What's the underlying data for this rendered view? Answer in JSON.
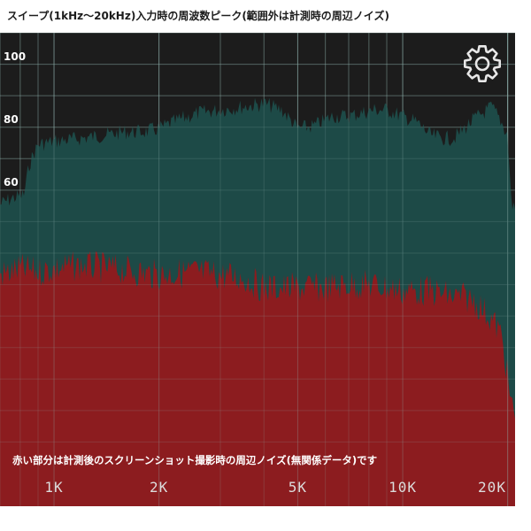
{
  "header": {
    "title": "スイープ(1kHz〜20kHz)入力時の周波数ピーク(範囲外は計測時の周辺ノイズ)"
  },
  "analyzer": {
    "caption": "赤い部分は計測後のスクリーンショット撮影時の周辺ノイズ(無関係データ)です",
    "settings_icon": "gear-icon",
    "colors": {
      "background": "#1c1c1c",
      "grid": "#8fb3ad",
      "sweep": "#1d4a47",
      "noise": "#8c1c1f"
    }
  },
  "chart_data": {
    "type": "area",
    "title": "",
    "xlabel": "",
    "ylabel": "",
    "x_scale": "log",
    "x_ticks": [
      {
        "value": 1000,
        "label": "1K"
      },
      {
        "value": 2000,
        "label": "2K"
      },
      {
        "value": 5000,
        "label": "5K"
      },
      {
        "value": 10000,
        "label": "10K"
      },
      {
        "value": 20000,
        "label": "20K"
      }
    ],
    "y_ticks": [
      {
        "value": 100,
        "label": "100"
      },
      {
        "value": 80,
        "label": "80"
      },
      {
        "value": 60,
        "label": "60"
      }
    ],
    "xlim": [
      700,
      21000
    ],
    "ylim": [
      -30,
      110
    ],
    "grid": true,
    "series": [
      {
        "color": "#1d4a47",
        "x": [
          700,
          760,
          820,
          850,
          900,
          1000,
          1200,
          1400,
          1600,
          1800,
          2000,
          2300,
          2600,
          3000,
          3500,
          4000,
          4500,
          5000,
          5600,
          6300,
          7000,
          7600,
          8300,
          9000,
          10000,
          11000,
          12000,
          13000,
          14000,
          15000,
          16000,
          17000,
          18000,
          19000,
          20000,
          20500,
          21000
        ],
        "y": [
          58,
          60,
          61,
          71,
          77,
          78,
          79,
          80,
          81,
          81,
          82,
          85,
          87,
          88,
          89,
          90,
          88,
          82,
          83,
          86,
          86,
          87,
          88,
          88,
          86,
          84,
          80,
          79,
          79,
          82,
          85,
          87,
          89,
          85,
          80,
          58,
          57
        ]
      },
      {
        "color": "#8c1c1f",
        "x": [
          700,
          800,
          900,
          1000,
          1200,
          1500,
          2000,
          2500,
          3000,
          3500,
          4000,
          5000,
          6000,
          7000,
          8000,
          9000,
          10000,
          11000,
          12000,
          13000,
          14000,
          15000,
          16000,
          17000,
          18000,
          19000,
          19500,
          20000,
          20500,
          21000
        ],
        "y": [
          38,
          40,
          39,
          40,
          41,
          40,
          38,
          39,
          38,
          37,
          34,
          34,
          34,
          35,
          35,
          34,
          33,
          33,
          33,
          32,
          31,
          31,
          30,
          27,
          24,
          20,
          15,
          5,
          -4,
          -6
        ]
      }
    ]
  }
}
